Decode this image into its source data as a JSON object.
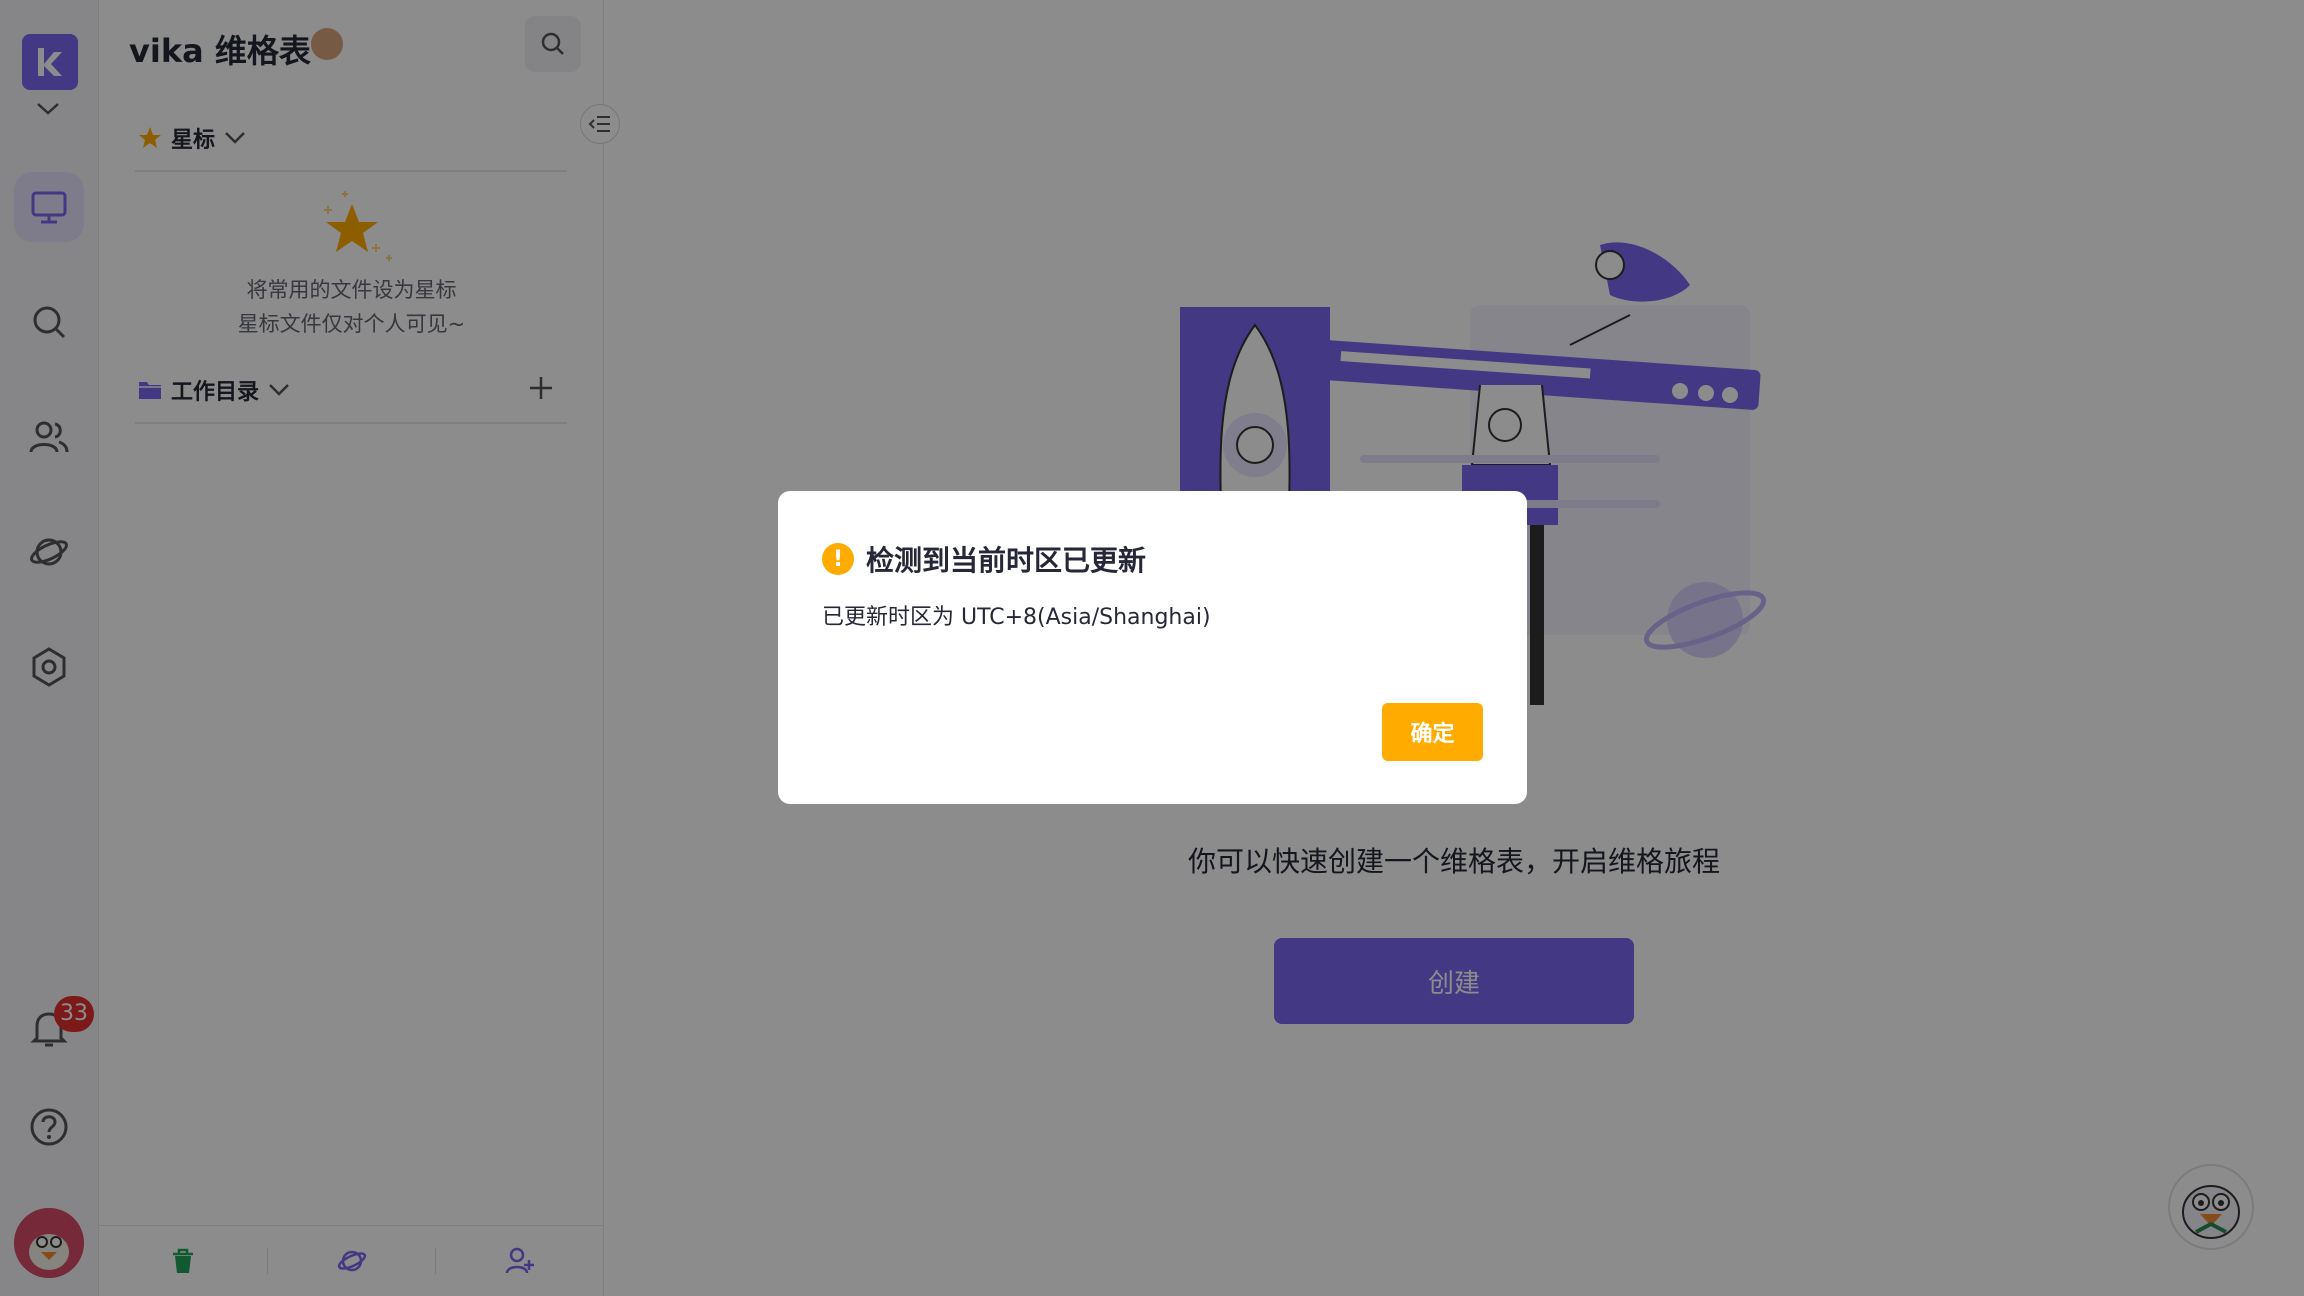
{
  "workspace": {
    "name": "vika 维格表"
  },
  "rail": {
    "notification_count": "33"
  },
  "sidebar": {
    "starred_label": "星标",
    "starred_empty_line1": "将常用的文件设为星标",
    "starred_empty_line2": "星标文件仅对个人可见~",
    "catalog_label": "工作目录"
  },
  "main": {
    "tip": "你可以快速创建一个维格表，开启维格旅程",
    "create_label": "创建"
  },
  "dialog": {
    "title": "检测到当前时区已更新",
    "message": "已更新时区为 UTC+8(Asia/Shanghai)",
    "confirm_label": "确定"
  },
  "colors": {
    "brand": "#7b67ee",
    "warning": "#ffab00",
    "badge": "#e0312e"
  }
}
